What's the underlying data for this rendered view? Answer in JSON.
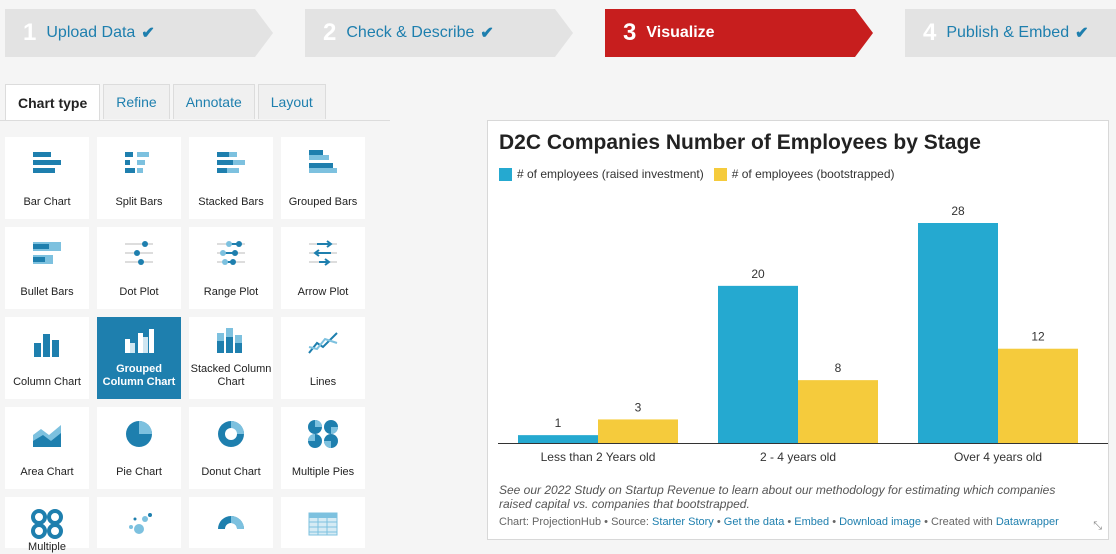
{
  "steps": [
    {
      "num": "1",
      "label": "Upload Data",
      "done": "✔"
    },
    {
      "num": "2",
      "label": "Check & Describe",
      "done": "✔"
    },
    {
      "num": "3",
      "label": "Visualize",
      "done": ""
    },
    {
      "num": "4",
      "label": "Publish & Embed",
      "done": "✔"
    }
  ],
  "tabs": [
    "Chart type",
    "Refine",
    "Annotate",
    "Layout"
  ],
  "chart_types": [
    {
      "label": "Bar Chart",
      "icon": "bar-chart-icon"
    },
    {
      "label": "Split Bars",
      "icon": "split-bars-icon"
    },
    {
      "label": "Stacked Bars",
      "icon": "stacked-bars-icon"
    },
    {
      "label": "Grouped Bars",
      "icon": "grouped-bars-icon"
    },
    {
      "label": "Bullet Bars",
      "icon": "bullet-bars-icon"
    },
    {
      "label": "Dot Plot",
      "icon": "dot-plot-icon"
    },
    {
      "label": "Range Plot",
      "icon": "range-plot-icon"
    },
    {
      "label": "Arrow Plot",
      "icon": "arrow-plot-icon"
    },
    {
      "label": "Column Chart",
      "icon": "column-chart-icon"
    },
    {
      "label": "Grouped Column Chart",
      "icon": "grouped-column-chart-icon",
      "selected": true
    },
    {
      "label": "Stacked Column Chart",
      "icon": "stacked-column-chart-icon"
    },
    {
      "label": "Lines",
      "icon": "lines-icon"
    },
    {
      "label": "Area Chart",
      "icon": "area-chart-icon"
    },
    {
      "label": "Pie Chart",
      "icon": "pie-chart-icon"
    },
    {
      "label": "Donut Chart",
      "icon": "donut-chart-icon"
    },
    {
      "label": "Multiple Pies",
      "icon": "multiple-pies-icon"
    },
    {
      "label": "Multiple",
      "icon": "multiple-donuts-icon"
    },
    {
      "label": "",
      "icon": "scatter-plot-icon"
    },
    {
      "label": "",
      "icon": "election-donut-icon"
    },
    {
      "label": "",
      "icon": "table-icon"
    }
  ],
  "chart_data": {
    "type": "bar",
    "title": "D2C Companies Number of Employees by Stage",
    "categories": [
      "Less than 2 Years old",
      "2 - 4 years old",
      "Over 4 years old"
    ],
    "series": [
      {
        "name": "# of employees (raised investment)",
        "values": [
          1,
          20,
          28
        ],
        "color": "#25a9d0"
      },
      {
        "name": "# of employees (bootstrapped)",
        "values": [
          3,
          8,
          12
        ],
        "color": "#f5cb3c"
      }
    ],
    "ylim": [
      0,
      28
    ],
    "grid": false,
    "legend": "top-left"
  },
  "notes": "See our 2022 Study on Startup Revenue to learn about our methodology for estimating which companies raised capital vs. companies that bootstrapped.",
  "footer": {
    "prefix": "Chart: ProjectionHub • Source: ",
    "source": "Starter Story",
    "sep1": " • ",
    "get_data": "Get the data",
    "sep2": " • ",
    "embed": "Embed",
    "sep3": " • ",
    "download": "Download image",
    "created": " • Created with ",
    "tool": "Datawrapper"
  },
  "resize_glyph": "⤡"
}
